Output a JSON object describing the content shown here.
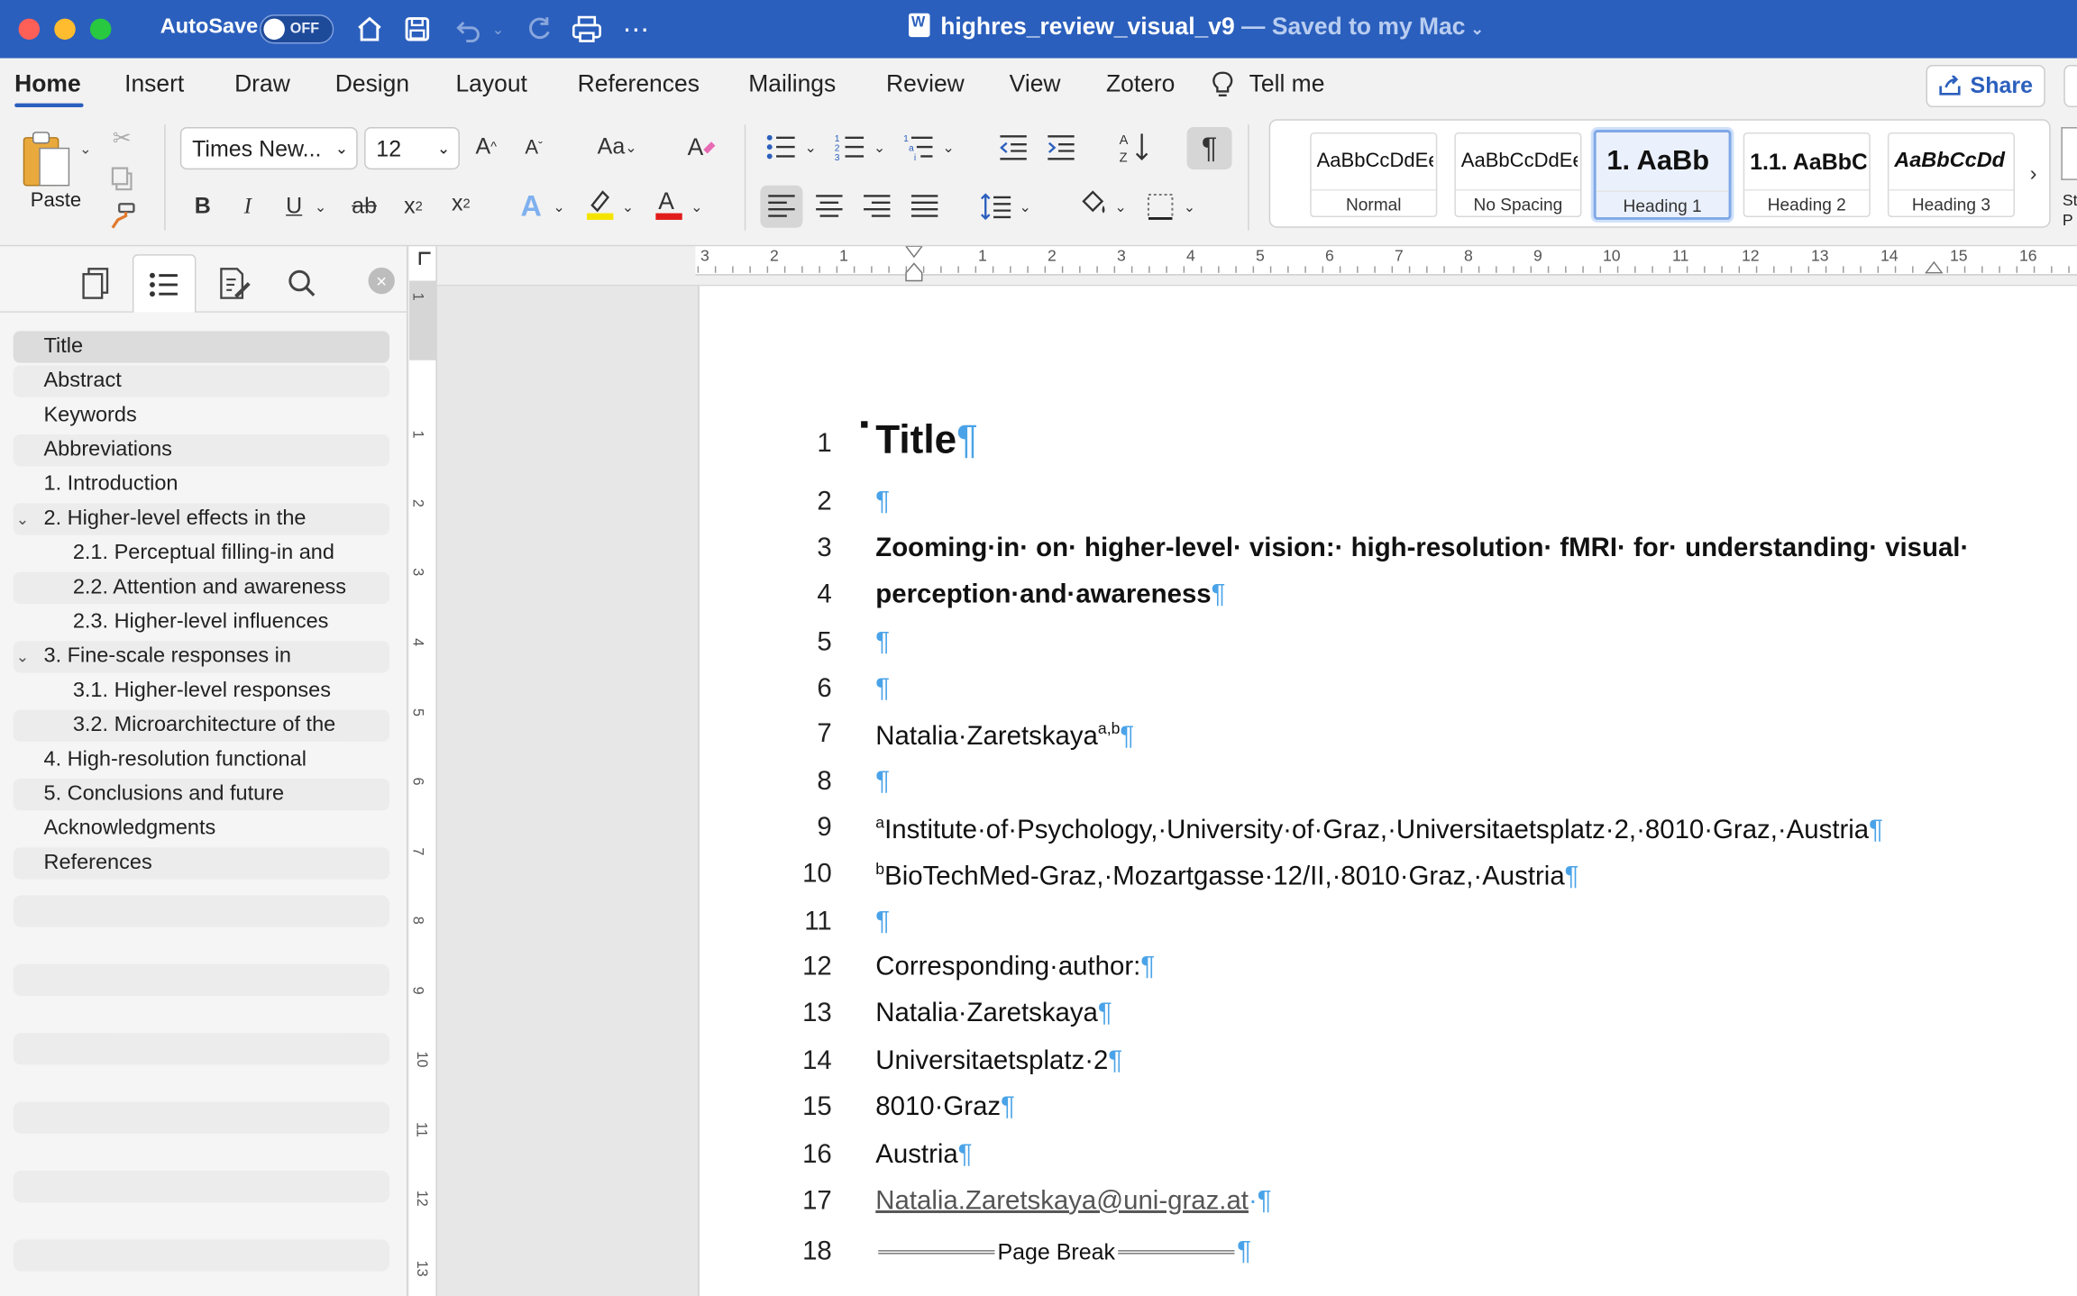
{
  "titlebar": {
    "autosave_label": "AutoSave",
    "autosave_state": "OFF",
    "doc_name": "highres_review_visual_v9",
    "doc_status": " — Saved to my Mac"
  },
  "menu": {
    "tabs": [
      "Home",
      "Insert",
      "Draw",
      "Design",
      "Layout",
      "References",
      "Mailings",
      "Review",
      "View",
      "Zotero"
    ],
    "tell_me": "Tell me",
    "share": "Share"
  },
  "ribbon": {
    "paste_label": "Paste",
    "font_name": "Times New...",
    "font_size": "12",
    "styles": [
      {
        "preview": "AaBbCcDdEe",
        "name": "Normal"
      },
      {
        "preview": "AaBbCcDdEe",
        "name": "No Spacing"
      },
      {
        "preview": "1.  AaBb",
        "name": "Heading 1"
      },
      {
        "preview": "1.1.  AaBbCc",
        "name": "Heading 2"
      },
      {
        "preview": "AaBbCcDd",
        "name": "Heading 3"
      }
    ],
    "styles_pane_label": "St P"
  },
  "nav": {
    "items": [
      {
        "label": "Title",
        "level": 1
      },
      {
        "label": "Abstract",
        "level": 1
      },
      {
        "label": "Keywords",
        "level": 1
      },
      {
        "label": "Abbreviations",
        "level": 1
      },
      {
        "label": "1. Introduction",
        "level": 1
      },
      {
        "label": "2. Higher-level effects in the",
        "level": 1
      },
      {
        "label": "2.1. Perceptual filling-in and",
        "level": 2
      },
      {
        "label": "2.2. Attention and awareness",
        "level": 2
      },
      {
        "label": "2.3. Higher-level influences",
        "level": 2
      },
      {
        "label": "3. Fine-scale responses in",
        "level": 1
      },
      {
        "label": "3.1. Higher-level responses",
        "level": 2
      },
      {
        "label": "3.2. Microarchitecture of the",
        "level": 2
      },
      {
        "label": "4. High-resolution functional",
        "level": 1
      },
      {
        "label": "5. Conclusions and future",
        "level": 1
      },
      {
        "label": "Acknowledgments",
        "level": 1
      },
      {
        "label": "References",
        "level": 1
      }
    ]
  },
  "ruler": {
    "h_numbers": [
      "3",
      "2",
      "1",
      "1",
      "2",
      "3",
      "4",
      "5",
      "6",
      "7",
      "8",
      "9",
      "10",
      "11",
      "12",
      "13",
      "14",
      "15",
      "16"
    ],
    "v_numbers": [
      "1",
      "1",
      "2",
      "3",
      "4",
      "5",
      "6",
      "7",
      "8",
      "9",
      "10",
      "11",
      "12",
      "13"
    ]
  },
  "document": {
    "line_numbers": [
      "1",
      "2",
      "3",
      "4",
      "5",
      "6",
      "7",
      "8",
      "9",
      "10",
      "11",
      "12",
      "13",
      "14",
      "15",
      "16",
      "17",
      "18"
    ],
    "title": "Title",
    "pilcrow": "¶",
    "heading_line1": "Zooming·in· on· higher-level· vision:· high-resolution· fMRI· for· understanding· visual·",
    "heading_line2": "perception·and·awareness",
    "author": "Natalia·Zaretskaya",
    "author_sup": "a,b",
    "affil_a_mark": "a",
    "affil_a": "Institute·of·Psychology,·University·of·Graz,·Universitaetsplatz·2,·8010·Graz,·Austria",
    "affil_b_mark": "b",
    "affil_b": "BioTechMed-Graz,·Mozartgasse·12/II,·8010·Graz,·Austria",
    "corr_label": "Corresponding·author:",
    "corr_name": "Natalia·Zaretskaya",
    "corr_street": "Universitaetsplatz·2",
    "corr_city": "8010·Graz",
    "corr_country": "Austria",
    "email": "Natalia.Zaretskaya@uni-graz.at",
    "email_trail": "·",
    "page_break": "Page Break"
  },
  "colors": {
    "titlebar": "#2b5fbd",
    "pilcrow": "#4aa3e8"
  }
}
